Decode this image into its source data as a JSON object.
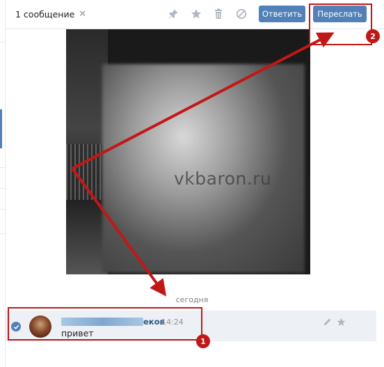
{
  "header": {
    "selection_label": "1 сообщение",
    "close_glyph": "✕",
    "tools": [
      "pin-icon",
      "star-icon",
      "trash-icon",
      "block-icon"
    ],
    "reply_label": "Ответить",
    "forward_label": "Переслать"
  },
  "photo": {
    "watermark": "vkbaron.ru"
  },
  "divider": {
    "date_label": "сегодня"
  },
  "message": {
    "author_visible_suffix": "еков",
    "time": "14:24",
    "text": "привет",
    "actions": [
      "edit-icon",
      "star-icon"
    ]
  },
  "annotations": {
    "badge_1": "1",
    "badge_2": "2",
    "color": "#c21717"
  },
  "colors": {
    "accent": "#5181b8",
    "selected_row": "#edf0f5",
    "link": "#2a5885"
  }
}
